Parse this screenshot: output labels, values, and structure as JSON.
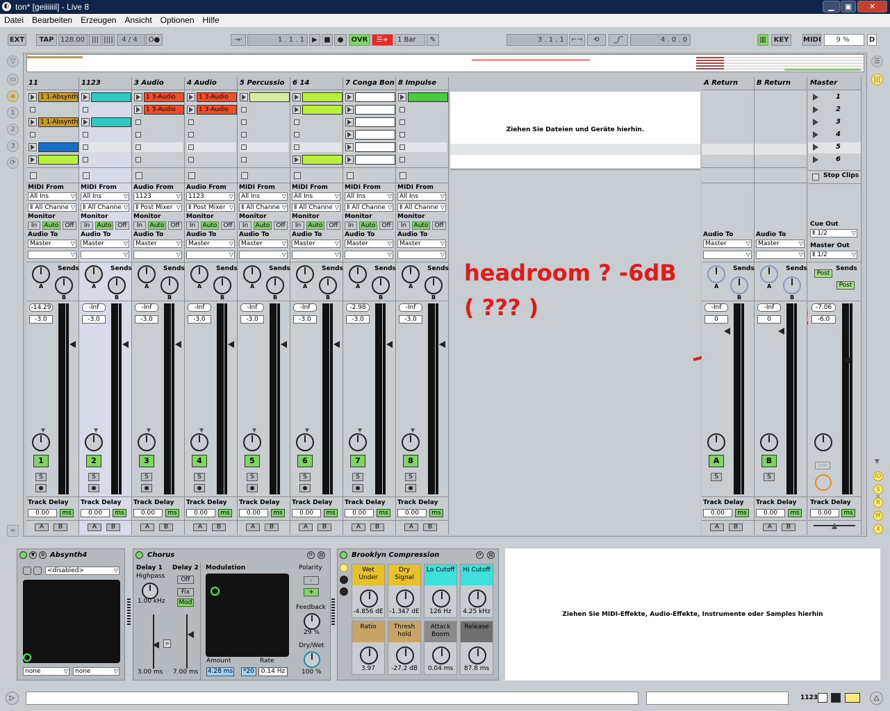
{
  "window": {
    "title": "ton*  [geiiiiiil] - Live 8",
    "min": "▁",
    "max": "▣",
    "close": "✕"
  },
  "menu": [
    "Datei",
    "Bearbeiten",
    "Erzeugen",
    "Ansicht",
    "Optionen",
    "Hilfe"
  ],
  "transport": {
    "ext": "EXT",
    "tap": "TAP",
    "bpm": "128.00",
    "sig": "4 / 4",
    "pos": "1 .   1 .   1",
    "ovr": "OVR",
    "quant": "1 Bar",
    "loop_start": "3 .   1 .   1",
    "loop_len": "4 .   0 .   0",
    "key": "KEY",
    "midi": "MIDI",
    "cpu": "9 %",
    "d": "D"
  },
  "tracks": [
    {
      "name": "11",
      "sel": false,
      "from_label": "MIDI From",
      "from": "All Ins",
      "chan": "Ⅱ All Channe",
      "mon_label": "Monitor",
      "mon_in": "In",
      "mon_auto": "Auto",
      "mon_off": "Off",
      "to_label": "Audio To",
      "to": "Master",
      "sends_label": "Sends",
      "sa": "A",
      "sb": "B",
      "vol_peak": "-14.29",
      "vol": "-3.0",
      "num": "1",
      "solo": "S",
      "td_label": "Track Delay",
      "td": "0.00",
      "ms": "ms",
      "a": "A",
      "b": "B",
      "clips": [
        {
          "c": "#c49a2e",
          "t": "1 1-Absynth"
        },
        {
          "stop": true
        },
        {
          "c": "#c49a2e",
          "t": "1 1-Absynth"
        },
        {
          "stop": true
        },
        {
          "c": "#1a6fc4",
          "t": ""
        },
        {
          "c": "#b9f03c",
          "t": ""
        }
      ]
    },
    {
      "name": "1123",
      "sel": true,
      "from_label": "MIDI From",
      "from": "All Ins",
      "chan": "Ⅱ All Channe",
      "mon_label": "Monitor",
      "mon_in": "In",
      "mon_auto": "Auto",
      "mon_off": "Off",
      "to_label": "Audio To",
      "to": "Master",
      "sends_label": "Sends",
      "sa": "A",
      "sb": "B",
      "vol_peak": "-Inf",
      "vol": "-3.0",
      "num": "2",
      "solo": "S",
      "td_label": "Track Delay",
      "td": "0.00",
      "ms": "ms",
      "a": "A",
      "b": "B",
      "clips": [
        {
          "c": "#2fc9c0",
          "t": ""
        },
        {
          "stop": true
        },
        {
          "c": "#2fc9c0",
          "t": ""
        },
        {
          "stop": true
        },
        {
          "stop": true
        },
        {
          "stop": true
        }
      ]
    },
    {
      "name": "3 Audio",
      "sel": false,
      "from_label": "Audio From",
      "from": "1123",
      "chan": "Ⅱ Post Mixer",
      "mon_label": "Monitor",
      "mon_in": "In",
      "mon_auto": "Auto",
      "mon_off": "Off",
      "to_label": "Audio To",
      "to": "Master",
      "sends_label": "Sends",
      "sa": "A",
      "sb": "B",
      "vol_peak": "-Inf",
      "vol": "-3.0",
      "num": "3",
      "solo": "S",
      "td_label": "Track Delay",
      "td": "0.00",
      "ms": "ms",
      "a": "A",
      "b": "B",
      "clips": [
        {
          "c": "#ee4f2b",
          "t": "1 3-Audio"
        },
        {
          "c": "#ee4f2b",
          "t": "1 3-Audio"
        },
        {
          "stop": true
        },
        {
          "stop": true
        },
        {
          "stop": true
        },
        {
          "stop": true
        }
      ]
    },
    {
      "name": "4 Audio",
      "sel": false,
      "from_label": "Audio From",
      "from": "1123",
      "chan": "Ⅱ Post Mixer",
      "mon_label": "Monitor",
      "mon_in": "In",
      "mon_auto": "Auto",
      "mon_off": "Off",
      "to_label": "Audio To",
      "to": "Master",
      "sends_label": "Sends",
      "sa": "A",
      "sb": "B",
      "vol_peak": "-Inf",
      "vol": "-3.0",
      "num": "4",
      "solo": "S",
      "td_label": "Track Delay",
      "td": "0.00",
      "ms": "ms",
      "a": "A",
      "b": "B",
      "clips": [
        {
          "c": "#ee4f2b",
          "t": "1 3-Audio"
        },
        {
          "c": "#ee4f2b",
          "t": "1 3-Audio"
        },
        {
          "stop": true
        },
        {
          "stop": true
        },
        {
          "stop": true
        },
        {
          "stop": true
        }
      ]
    },
    {
      "name": "5 Percussio",
      "sel": false,
      "from_label": "MIDI From",
      "from": "All Ins",
      "chan": "Ⅱ All Channe",
      "mon_label": "Monitor",
      "mon_in": "In",
      "mon_auto": "Auto",
      "mon_off": "Off",
      "to_label": "Audio To",
      "to": "Master",
      "sends_label": "Sends",
      "sa": "A",
      "sb": "B",
      "vol_peak": "-Inf",
      "vol": "-3.0",
      "num": "5",
      "solo": "S",
      "td_label": "Track Delay",
      "td": "0.00",
      "ms": "ms",
      "a": "A",
      "b": "B",
      "clips": [
        {
          "c": "#d6eda0",
          "t": ""
        },
        {
          "stop": true
        },
        {
          "stop": true
        },
        {
          "stop": true
        },
        {
          "stop": true
        },
        {
          "stop": true
        }
      ]
    },
    {
      "name": "6 14",
      "sel": false,
      "from_label": "MIDI From",
      "from": "All Ins",
      "chan": "Ⅱ All Channe",
      "mon_label": "Monitor",
      "mon_in": "In",
      "mon_auto": "Auto",
      "mon_off": "Off",
      "to_label": "Audio To",
      "to": "Master",
      "sends_label": "Sends",
      "sa": "A",
      "sb": "B",
      "vol_peak": "-Inf",
      "vol": "-3.0",
      "num": "6",
      "solo": "S",
      "td_label": "Track Delay",
      "td": "0.00",
      "ms": "ms",
      "a": "A",
      "b": "B",
      "clips": [
        {
          "c": "#b9f03c",
          "t": ""
        },
        {
          "c": "#b9f03c",
          "t": ""
        },
        {
          "stop": true
        },
        {
          "stop": true
        },
        {
          "stop": true
        },
        {
          "c": "#b9f03c",
          "t": ""
        }
      ]
    },
    {
      "name": "7 Conga Bon",
      "sel": false,
      "from_label": "MIDI From",
      "from": "All Ins",
      "chan": "Ⅱ All Channe",
      "mon_label": "Monitor",
      "mon_in": "In",
      "mon_auto": "Auto",
      "mon_off": "Off",
      "to_label": "Audio To",
      "to": "Master",
      "sends_label": "Sends",
      "sa": "A",
      "sb": "B",
      "vol_peak": "-2.98",
      "vol": "-3.0",
      "num": "7",
      "solo": "S",
      "td_label": "Track Delay",
      "td": "0.00",
      "ms": "ms",
      "a": "A",
      "b": "B",
      "clips": [
        {
          "c": "#ffffff",
          "t": ""
        },
        {
          "c": "#ffffff",
          "t": ""
        },
        {
          "c": "#ffffff",
          "t": ""
        },
        {
          "c": "#ffffff",
          "t": ""
        },
        {
          "c": "#ffffff",
          "t": ""
        },
        {
          "c": "#ffffff",
          "t": ""
        }
      ]
    },
    {
      "name": "8 Impulse",
      "sel": false,
      "from_label": "MIDI From",
      "from": "All Ins",
      "chan": "Ⅱ All Channe",
      "mon_label": "Monitor",
      "mon_in": "In",
      "mon_auto": "Auto",
      "mon_off": "Off",
      "to_label": "Audio To",
      "to": "Master",
      "sends_label": "Sends",
      "sa": "A",
      "sb": "B",
      "vol_peak": "-Inf",
      "vol": "-3.0",
      "num": "8",
      "solo": "S",
      "td_label": "Track Delay",
      "td": "0.00",
      "ms": "ms",
      "a": "A",
      "b": "B",
      "clips": [
        {
          "c": "#49c93d",
          "t": ""
        },
        {
          "stop": true
        },
        {
          "stop": true
        },
        {
          "stop": true
        },
        {
          "stop": true
        },
        {
          "stop": true
        }
      ]
    }
  ],
  "dropzone_session": "Ziehen Sie Dateien und Geräte hierhin.",
  "annotation": {
    "line1": "headroom ? -6dB",
    "line2": "( ??? )",
    "color": "#e11a1a"
  },
  "returns": [
    {
      "name": "A Return",
      "to_label": "Audio To",
      "to": "Master",
      "sends_label": "Sends",
      "sa": "A",
      "sb": "B",
      "vol_peak": "-Inf",
      "vol": "0",
      "btn": "A",
      "solo": "S",
      "td_label": "Track Delay",
      "td": "0.00",
      "ms": "ms",
      "a": "A",
      "b": "B"
    },
    {
      "name": "B Return",
      "to_label": "Audio To",
      "to": "Master",
      "sends_label": "Sends",
      "sa": "A",
      "sb": "B",
      "vol_peak": "-Inf",
      "vol": "0",
      "btn": "B",
      "solo": "S",
      "td_label": "Track Delay",
      "td": "0.00",
      "ms": "ms",
      "a": "A",
      "b": "B"
    }
  ],
  "master": {
    "name": "Master",
    "scenes": [
      "1",
      "2",
      "3",
      "4",
      "5",
      "6"
    ],
    "stop_clips": "Stop Clips",
    "cue_label": "Cue Out",
    "cue": "Ⅱ 1/2",
    "out_label": "Master Out",
    "out": "Ⅱ 1/2",
    "sends_label": "Sends",
    "post": "Post",
    "vol_peak": "-7.06",
    "vol": "-6.0",
    "solo": "Solo",
    "td_label": "Track Delay",
    "td": "0.00",
    "ms": "ms"
  },
  "devices": {
    "absynth": {
      "name": "Absynth4",
      "preset": "<disabled>",
      "out1": "none",
      "out2": "none"
    },
    "chorus": {
      "name": "Chorus",
      "delay1": "Delay 1",
      "highpass": "Highpass",
      "hp_val": "1.00 kHz",
      "delay2": "Delay 2",
      "off": "Off",
      "fix": "Fix",
      "mod": "Mod",
      "d1_val": "3.00 ms",
      "d2_val": "7.00 ms",
      "modulation": "Modulation",
      "amount": "Amount",
      "amount_val": "4.28 ms",
      "rate": "Rate",
      "rate_x": "*20",
      "rate_val": "0.14 Hz",
      "polarity": "Polarity",
      "pol_minus": "-",
      "pol_plus": "+",
      "feedback": "Feedback",
      "fb_val": "29 %",
      "drywet": "Dry/Wet",
      "dw_val": "100 %"
    },
    "brooklyn": {
      "name": "Brooklyn Compression",
      "params": [
        {
          "l": "Wet Under",
          "v": "-4.856 dE",
          "c": "#e6c12e"
        },
        {
          "l": "Dry Signal",
          "v": "-1.347 dE",
          "c": "#e6c12e"
        },
        {
          "l": "Lo Cutoff",
          "v": "126 Hz",
          "c": "#3de0da"
        },
        {
          "l": "Hi Cutoff",
          "v": "4.25 kHz",
          "c": "#3de0da"
        },
        {
          "l": "Ratio",
          "v": "3.97",
          "c": "#c7a665"
        },
        {
          "l": "Thresh hold",
          "v": "-27.2 dB",
          "c": "#c7a665"
        },
        {
          "l": "Attack Boom",
          "v": "0.04 ms",
          "c": "#8a8a8a"
        },
        {
          "l": "Release",
          "v": "87.8 ms",
          "c": "#6f6f6f"
        }
      ]
    },
    "dropzone": "Ziehen Sie MIDI-Effekte, Audio-Effekte, Instrumente oder Samples hierhin"
  },
  "status": {
    "track": "1123"
  }
}
